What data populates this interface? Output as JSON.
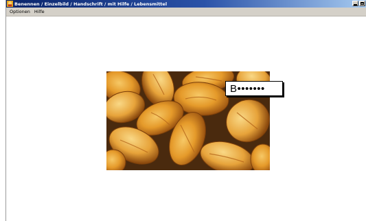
{
  "window": {
    "title": "Benennen / Einzelbild / Handschrift / mit Hilfe / Lebensmittel"
  },
  "menu": {
    "items": [
      {
        "label": "Optionen"
      },
      {
        "label": "Hilfe"
      }
    ]
  },
  "picture": {
    "subject": "bread-rolls-image"
  },
  "answer": {
    "value": "B•••••••"
  }
}
